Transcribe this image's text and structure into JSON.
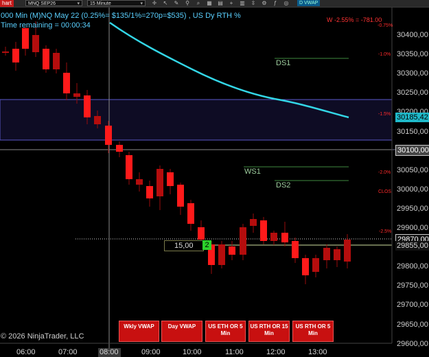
{
  "toolbar": {
    "chart_tab": "hart",
    "instrument": "MNQ SEP26",
    "interval": "15 Minute",
    "vwap_tab": "D VWAP",
    "icons": [
      "crosshair-icon",
      "arrow-icon",
      "draw-icon",
      "magnet-icon",
      "zoom-icon",
      "grid-icon",
      "template-icon",
      "plus-icon",
      "chart-icon",
      "scale-icon",
      "settings-icon",
      "indicators-icon",
      "strategy-icon"
    ]
  },
  "header": {
    "series_line": "000 Min (M)NQ May 22 (0.25%= $135/1%=270p=$535) , US Dy RTH %",
    "time_remaining": "Time remaining = 00:00:34",
    "w_indicator": "W -2.55% = -781.00"
  },
  "pct_labels": [
    "-0.75%",
    "-1.0%",
    "-1.5%",
    "-2.0%",
    "CLOS",
    "-2.5%"
  ],
  "levels": {
    "ds1": "DS1",
    "ws1": "WS1",
    "ds2": "DS2"
  },
  "price_axis": [
    "30400,00",
    "30350,00",
    "30300,00",
    "30250,00",
    "30200,00",
    "30150,00",
    "30100,00",
    "30050,00",
    "30000,00",
    "29950,00",
    "29900,00",
    "29850,00",
    "29800,00",
    "29750,00",
    "29700,00",
    "29650,00",
    "29600,00"
  ],
  "price_badges": {
    "vwap": "30185,42",
    "box_low": "30100,00",
    "last": "29870,00",
    "bid": "29855,00"
  },
  "time_axis": [
    "06:00",
    "07:00",
    "08:00",
    "09:00",
    "10:00",
    "11:00",
    "12:00",
    "13:00"
  ],
  "order_marker": {
    "qty": "15,00",
    "count": "2"
  },
  "buttons": [
    "Wkly VWAP",
    "Day VWAP",
    "US ETH OR 5 Min",
    "US RTH OR 15 Min",
    "US RTH OR 5 Min"
  ],
  "copyright": "© 2026 NinjaTrader, LLC",
  "colors": {
    "up": "#ff1a1a",
    "down": "#b50d0d",
    "vwap": "#33d6e6",
    "box": "#5a57c8"
  }
}
